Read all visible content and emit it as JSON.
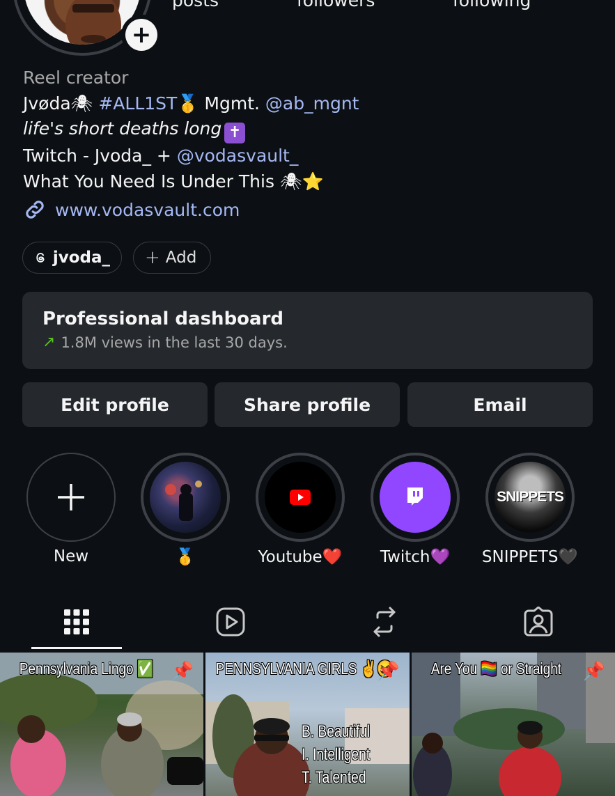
{
  "stats": {
    "posts_label": "posts",
    "followers_label": "followers",
    "following_label": "following"
  },
  "bio": {
    "category": "Reel creator",
    "line1_name": "Jvøda",
    "line1_spider": "🕷",
    "line1_tag": "#ALL1ST",
    "line1_medal": "🥇",
    "line1_mgmt": "Mgmt.",
    "line1_handle": "@ab_mgnt",
    "line2": "life's short deaths long",
    "line2_cross": "✝",
    "line3_prefix": "Twitch - Jvoda_ +",
    "line3_handle": "@vodasvault_",
    "line4": "What You Need Is Under This",
    "line4_spider": "🕷",
    "line4_star": "⭐",
    "url": "www.vodasvault.com"
  },
  "pills": {
    "threads_handle": "jvoda_",
    "add_label": "Add"
  },
  "dashboard": {
    "title": "Professional dashboard",
    "subtitle": "1.8M views in the last 30 days."
  },
  "buttons": {
    "edit": "Edit profile",
    "share": "Share profile",
    "email": "Email"
  },
  "highlights": [
    {
      "label": "New"
    },
    {
      "label": "🥇"
    },
    {
      "label": "Youtube❤️"
    },
    {
      "label": "Twitch💜"
    },
    {
      "label": "SNIPPETS🖤",
      "cover_text": "SNIPPETS"
    }
  ],
  "tabs": [
    "grid-icon",
    "reels-icon",
    "reposts-icon",
    "tagged-icon"
  ],
  "posts": [
    {
      "caption": "Pennsylvania Lingo ✅",
      "pinned": true
    },
    {
      "caption": "PENNSYLVANIA GIRLS ✌😆",
      "pinned": true,
      "lines": [
        "B. Beautiful",
        "I. Intelligent",
        "T. Talented"
      ]
    },
    {
      "caption": "Are You 🏳️‍🌈 or Straight",
      "pinned": true
    }
  ],
  "colors": {
    "background": "#0c1014",
    "card": "#25292e",
    "link": "#a5b8f3",
    "twitch": "#9147ff",
    "youtube": "#ff0000",
    "trend": "#58c322"
  }
}
